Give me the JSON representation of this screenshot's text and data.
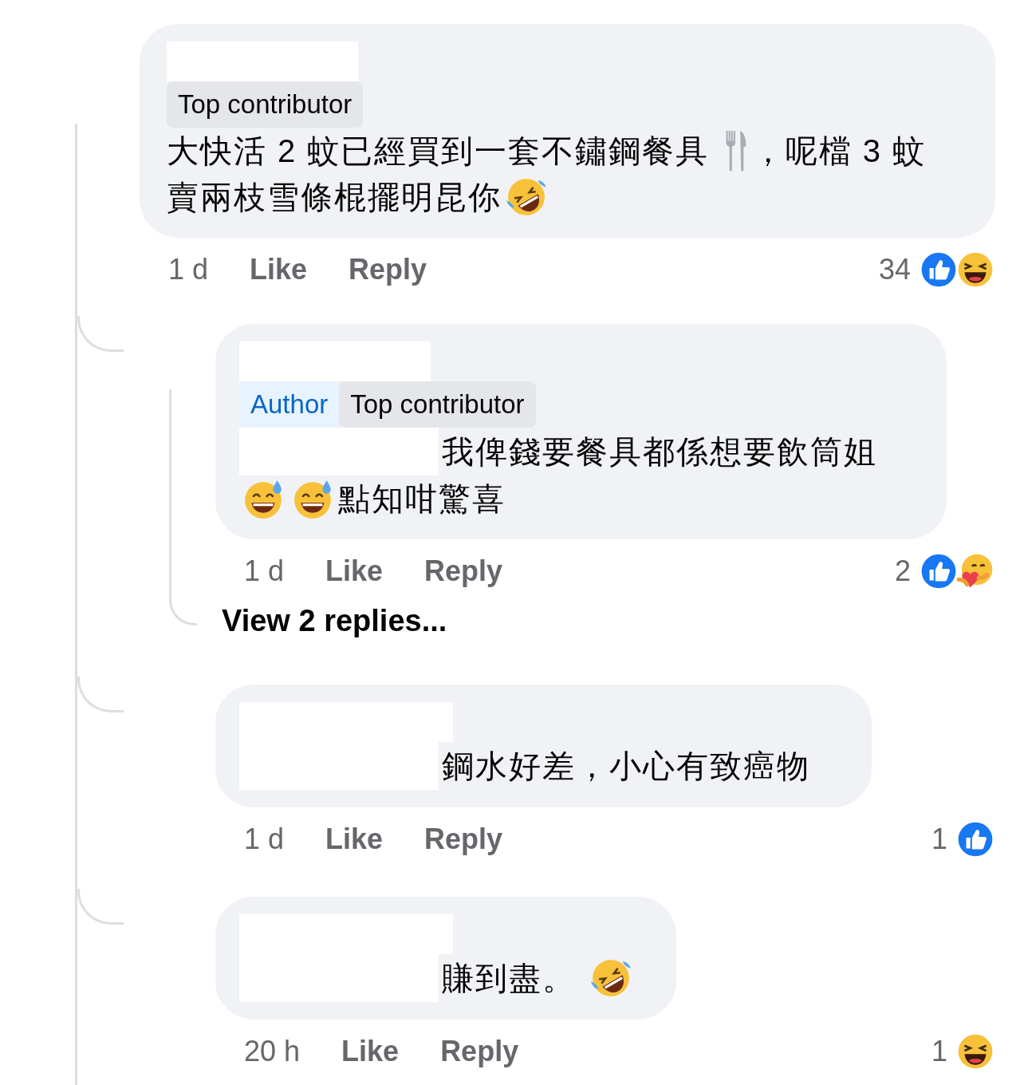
{
  "comment": {
    "badges": [
      {
        "kind": "contributor",
        "label": "Top contributor"
      }
    ],
    "lines": [
      [
        {
          "kind": "text",
          "text": "大快活 2 蚊已經買到一套不鏽鋼餐具 "
        },
        {
          "kind": "cutlery"
        },
        {
          "kind": "text",
          "text": "，呢檔 3 蚊"
        }
      ],
      [
        {
          "kind": "text",
          "text": "賣兩枝雪條棍擺明昆你"
        },
        {
          "kind": "rofl"
        }
      ]
    ],
    "time": "1 d",
    "actions": [
      "Like",
      "Reply"
    ],
    "reaction_count": "34",
    "reactions": [
      {
        "kind": "like"
      },
      {
        "kind": "haha"
      }
    ],
    "replies": [
      {
        "badges": [
          {
            "kind": "author",
            "label": "Author"
          },
          {
            "kind": "contributor",
            "label": "Top contributor"
          }
        ],
        "lines": [
          [
            {
              "kind": "redaction"
            },
            {
              "kind": "text",
              "text": "我俾錢要餐具都係想要飲筒姐"
            }
          ],
          [
            {
              "kind": "sweat-smile"
            },
            {
              "kind": "sweat-smile"
            },
            {
              "kind": "text",
              "text": "點知咁驚喜"
            }
          ]
        ],
        "time": "1 d",
        "actions": [
          "Like",
          "Reply"
        ],
        "reaction_count": "2",
        "reactions": [
          {
            "kind": "like"
          },
          {
            "kind": "care"
          }
        ],
        "view_replies": "View 2 replies..."
      },
      {
        "lines": [
          [
            {
              "kind": "redaction"
            },
            {
              "kind": "text",
              "text": "鋼水好差，小心有致癌物"
            }
          ]
        ],
        "time": "1 d",
        "actions": [
          "Like",
          "Reply"
        ],
        "reaction_count": "1",
        "reactions": [
          {
            "kind": "like"
          }
        ]
      },
      {
        "lines": [
          [
            {
              "kind": "redaction"
            },
            {
              "kind": "text",
              "text": "賺到盡。 "
            },
            {
              "kind": "rofl"
            }
          ]
        ],
        "time": "20 h",
        "actions": [
          "Like",
          "Reply"
        ],
        "reaction_count": "1",
        "reactions": [
          {
            "kind": "haha"
          }
        ]
      }
    ]
  }
}
